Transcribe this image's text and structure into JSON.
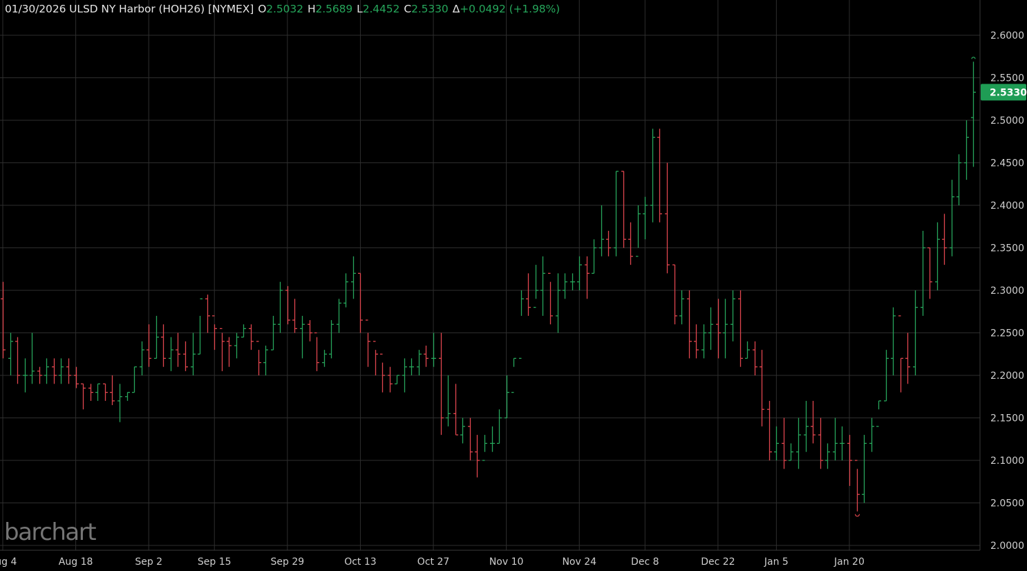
{
  "header": {
    "title": "01/30/2026 ULSD NY Harbor (HOH26) [NYMEX]",
    "open_label": "O",
    "open": "2.5032",
    "high_label": "H",
    "high": "2.5689",
    "low_label": "L",
    "low": "2.4452",
    "close_label": "C",
    "close": "2.5330",
    "change_label": "Δ",
    "change": "+0.0492 (+1.98%)"
  },
  "logo": "barchart",
  "colors": {
    "up": "#26a65b",
    "down": "#e0464e",
    "grid": "#2e2e2e",
    "badge": "#1f9d55"
  },
  "chart_data": {
    "type": "ohlc",
    "last_price": 2.533,
    "last_price_label": "2.5330",
    "ylim": [
      2.0,
      2.6
    ],
    "yticks": [
      "2.6000",
      "2.5500",
      "2.5000",
      "2.4500",
      "2.4000",
      "2.3500",
      "2.3000",
      "2.2500",
      "2.2000",
      "2.1500",
      "2.1000",
      "2.0500",
      "2.0000"
    ],
    "xticks": [
      {
        "label": "Aug 4",
        "index": 0
      },
      {
        "label": "Aug 18",
        "index": 10
      },
      {
        "label": "Sep 2",
        "index": 20
      },
      {
        "label": "Sep 15",
        "index": 29
      },
      {
        "label": "Sep 29",
        "index": 39
      },
      {
        "label": "Oct 13",
        "index": 49
      },
      {
        "label": "Oct 27",
        "index": 59
      },
      {
        "label": "Nov 10",
        "index": 69
      },
      {
        "label": "Nov 24",
        "index": 79
      },
      {
        "label": "Dec 8",
        "index": 88
      },
      {
        "label": "Dec 22",
        "index": 98
      },
      {
        "label": "Jan 5",
        "index": 106
      },
      {
        "label": "Jan 20",
        "index": 116
      }
    ],
    "bars": [
      [
        2.29,
        2.31,
        2.22,
        2.23
      ],
      [
        2.22,
        2.25,
        2.2,
        2.24
      ],
      [
        2.24,
        2.245,
        2.19,
        2.2
      ],
      [
        2.2,
        2.22,
        2.18,
        2.2
      ],
      [
        2.2,
        2.25,
        2.19,
        2.205
      ],
      [
        2.205,
        2.21,
        2.19,
        2.2
      ],
      [
        2.2,
        2.22,
        2.19,
        2.21
      ],
      [
        2.21,
        2.22,
        2.19,
        2.2
      ],
      [
        2.2,
        2.22,
        2.19,
        2.21
      ],
      [
        2.21,
        2.22,
        2.19,
        2.2
      ],
      [
        2.2,
        2.21,
        2.185,
        2.19
      ],
      [
        2.19,
        2.19,
        2.16,
        2.185
      ],
      [
        2.185,
        2.19,
        2.17,
        2.18
      ],
      [
        2.18,
        2.19,
        2.17,
        2.19
      ],
      [
        2.19,
        2.19,
        2.17,
        2.18
      ],
      [
        2.18,
        2.2,
        2.165,
        2.17
      ],
      [
        2.17,
        2.19,
        2.145,
        2.175
      ],
      [
        2.175,
        2.18,
        2.17,
        2.18
      ],
      [
        2.18,
        2.21,
        2.18,
        2.21
      ],
      [
        2.21,
        2.24,
        2.2,
        2.23
      ],
      [
        2.23,
        2.26,
        2.21,
        2.22
      ],
      [
        2.22,
        2.27,
        2.22,
        2.245
      ],
      [
        2.245,
        2.26,
        2.21,
        2.22
      ],
      [
        2.22,
        2.245,
        2.205,
        2.23
      ],
      [
        2.23,
        2.25,
        2.21,
        2.225
      ],
      [
        2.225,
        2.24,
        2.205,
        2.21
      ],
      [
        2.21,
        2.25,
        2.2,
        2.225
      ],
      [
        2.225,
        2.27,
        2.225,
        2.29
      ],
      [
        2.29,
        2.295,
        2.25,
        2.27
      ],
      [
        2.27,
        2.26,
        2.23,
        2.255
      ],
      [
        2.255,
        2.25,
        2.205,
        2.24
      ],
      [
        2.24,
        2.245,
        2.21,
        2.235
      ],
      [
        2.235,
        2.25,
        2.22,
        2.245
      ],
      [
        2.245,
        2.26,
        2.245,
        2.255
      ],
      [
        2.255,
        2.26,
        2.23,
        2.24
      ],
      [
        2.24,
        2.23,
        2.2,
        2.215
      ],
      [
        2.215,
        2.235,
        2.2,
        2.23
      ],
      [
        2.23,
        2.27,
        2.23,
        2.26
      ],
      [
        2.26,
        2.31,
        2.25,
        2.3
      ],
      [
        2.3,
        2.305,
        2.26,
        2.265
      ],
      [
        2.265,
        2.29,
        2.25,
        2.255
      ],
      [
        2.255,
        2.27,
        2.22,
        2.26
      ],
      [
        2.26,
        2.265,
        2.24,
        2.25
      ],
      [
        2.25,
        2.245,
        2.205,
        2.215
      ],
      [
        2.215,
        2.23,
        2.21,
        2.225
      ],
      [
        2.225,
        2.265,
        2.22,
        2.26
      ],
      [
        2.26,
        2.29,
        2.25,
        2.285
      ],
      [
        2.285,
        2.32,
        2.28,
        2.31
      ],
      [
        2.31,
        2.34,
        2.29,
        2.32
      ],
      [
        2.32,
        2.32,
        2.25,
        2.265
      ],
      [
        2.265,
        2.25,
        2.21,
        2.24
      ],
      [
        2.24,
        2.23,
        2.2,
        2.225
      ],
      [
        2.225,
        2.215,
        2.18,
        2.2
      ],
      [
        2.2,
        2.21,
        2.18,
        2.19
      ],
      [
        2.19,
        2.2,
        2.19,
        2.2
      ],
      [
        2.2,
        2.22,
        2.18,
        2.21
      ],
      [
        2.21,
        2.22,
        2.2,
        2.21
      ],
      [
        2.21,
        2.23,
        2.2,
        2.225
      ],
      [
        2.225,
        2.235,
        2.21,
        2.22
      ],
      [
        2.22,
        2.25,
        2.21,
        2.22
      ],
      [
        2.22,
        2.25,
        2.13,
        2.15
      ],
      [
        2.15,
        2.2,
        2.14,
        2.155
      ],
      [
        2.155,
        2.19,
        2.13,
        2.13
      ],
      [
        2.13,
        2.15,
        2.12,
        2.14
      ],
      [
        2.14,
        2.15,
        2.1,
        2.11
      ],
      [
        2.11,
        2.13,
        2.08,
        2.1
      ],
      [
        2.1,
        2.13,
        2.11,
        2.12
      ],
      [
        2.12,
        2.14,
        2.11,
        2.12
      ],
      [
        2.12,
        2.16,
        2.12,
        2.15
      ],
      [
        2.15,
        2.2,
        2.15,
        2.18
      ],
      [
        2.18,
        2.22,
        2.21,
        2.22
      ],
      [
        2.22,
        2.3,
        2.27,
        2.29
      ],
      [
        2.29,
        2.32,
        2.27,
        2.28
      ],
      [
        2.28,
        2.33,
        2.29,
        2.3
      ],
      [
        2.3,
        2.34,
        2.27,
        2.32
      ],
      [
        2.32,
        2.31,
        2.26,
        2.27
      ],
      [
        2.27,
        2.32,
        2.25,
        2.3
      ],
      [
        2.3,
        2.32,
        2.29,
        2.31
      ],
      [
        2.31,
        2.32,
        2.3,
        2.31
      ],
      [
        2.31,
        2.34,
        2.3,
        2.33
      ],
      [
        2.33,
        2.34,
        2.29,
        2.32
      ],
      [
        2.32,
        2.36,
        2.32,
        2.35
      ],
      [
        2.35,
        2.4,
        2.34,
        2.36
      ],
      [
        2.36,
        2.37,
        2.34,
        2.35
      ],
      [
        2.35,
        2.44,
        2.34,
        2.44
      ],
      [
        2.44,
        2.44,
        2.35,
        2.36
      ],
      [
        2.36,
        2.38,
        2.33,
        2.34
      ],
      [
        2.34,
        2.4,
        2.35,
        2.39
      ],
      [
        2.39,
        2.41,
        2.36,
        2.4
      ],
      [
        2.4,
        2.49,
        2.38,
        2.48
      ],
      [
        2.48,
        2.49,
        2.38,
        2.39
      ],
      [
        2.39,
        2.45,
        2.32,
        2.33
      ],
      [
        2.33,
        2.33,
        2.26,
        2.27
      ],
      [
        2.27,
        2.3,
        2.26,
        2.29
      ],
      [
        2.29,
        2.3,
        2.22,
        2.24
      ],
      [
        2.24,
        2.26,
        2.22,
        2.23
      ],
      [
        2.23,
        2.26,
        2.22,
        2.25
      ],
      [
        2.25,
        2.28,
        2.23,
        2.26
      ],
      [
        2.26,
        2.29,
        2.22,
        2.25
      ],
      [
        2.25,
        2.29,
        2.22,
        2.26
      ],
      [
        2.26,
        2.3,
        2.24,
        2.29
      ],
      [
        2.29,
        2.3,
        2.21,
        2.22
      ],
      [
        2.22,
        2.24,
        2.22,
        2.23
      ],
      [
        2.23,
        2.24,
        2.2,
        2.21
      ],
      [
        2.21,
        2.23,
        2.14,
        2.16
      ],
      [
        2.16,
        2.17,
        2.1,
        2.11
      ],
      [
        2.11,
        2.14,
        2.1,
        2.12
      ],
      [
        2.12,
        2.15,
        2.09,
        2.1
      ],
      [
        2.1,
        2.12,
        2.1,
        2.11
      ],
      [
        2.11,
        2.15,
        2.09,
        2.13
      ],
      [
        2.13,
        2.17,
        2.11,
        2.14
      ],
      [
        2.14,
        2.17,
        2.12,
        2.13
      ],
      [
        2.13,
        2.15,
        2.09,
        2.1
      ],
      [
        2.1,
        2.12,
        2.09,
        2.11
      ],
      [
        2.11,
        2.15,
        2.1,
        2.12
      ],
      [
        2.12,
        2.14,
        2.1,
        2.12
      ],
      [
        2.12,
        2.13,
        2.07,
        2.1
      ],
      [
        2.1,
        2.09,
        2.04,
        2.06
      ],
      [
        2.06,
        2.13,
        2.05,
        2.12
      ],
      [
        2.12,
        2.15,
        2.11,
        2.14
      ],
      [
        2.14,
        2.17,
        2.16,
        2.17
      ],
      [
        2.17,
        2.23,
        2.17,
        2.22
      ],
      [
        2.22,
        2.28,
        2.2,
        2.27
      ],
      [
        2.27,
        2.22,
        2.18,
        2.22
      ],
      [
        2.22,
        2.25,
        2.19,
        2.21
      ],
      [
        2.21,
        2.3,
        2.2,
        2.28
      ],
      [
        2.28,
        2.37,
        2.27,
        2.35
      ],
      [
        2.35,
        2.35,
        2.29,
        2.31
      ],
      [
        2.31,
        2.38,
        2.3,
        2.36
      ],
      [
        2.36,
        2.39,
        2.33,
        2.35
      ],
      [
        2.35,
        2.43,
        2.34,
        2.41
      ],
      [
        2.41,
        2.46,
        2.4,
        2.45
      ],
      [
        2.45,
        2.5,
        2.43,
        2.48
      ],
      [
        2.5032,
        2.5689,
        2.4452,
        2.533
      ]
    ]
  }
}
